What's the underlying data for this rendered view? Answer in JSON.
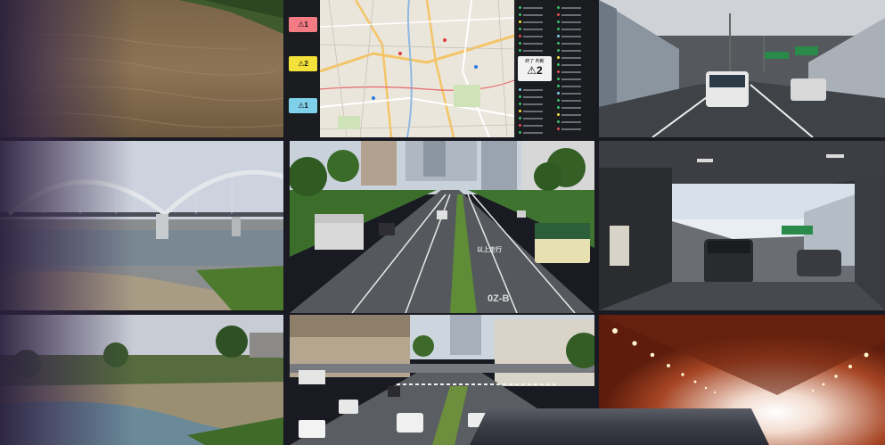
{
  "dashboard": {
    "levels": [
      {
        "label": "⚠1",
        "color": "#f27b84"
      },
      {
        "label": "⚠2",
        "color": "#f4e23a"
      },
      {
        "label": "⚠1",
        "color": "#7fd0ea"
      }
    ],
    "status_caption": "終了 判断",
    "status_value": "⚠2"
  },
  "road": {
    "marking_top": "以上走行",
    "marking_bottom": "0Z-B"
  }
}
